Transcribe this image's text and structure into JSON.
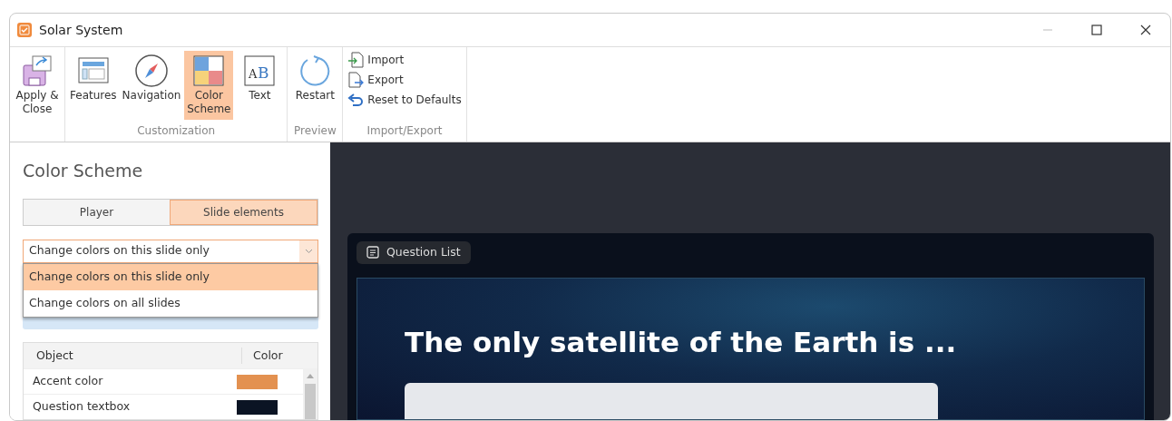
{
  "window": {
    "title": "Solar System"
  },
  "ribbon": {
    "groups": [
      {
        "items": [
          {
            "label": "Apply & Close",
            "kind": "large",
            "selected": false
          }
        ]
      },
      {
        "label": "Customization",
        "items": [
          {
            "label": "Features",
            "kind": "large",
            "selected": false
          },
          {
            "label": "Navigation",
            "kind": "large",
            "selected": false
          },
          {
            "label": "Color Scheme",
            "kind": "large",
            "selected": true
          },
          {
            "label": "Text",
            "kind": "large",
            "selected": false,
            "icon_letters": [
              "A",
              "B"
            ]
          }
        ]
      },
      {
        "label": "Preview",
        "items": [
          {
            "label": "Restart",
            "kind": "large",
            "selected": false
          }
        ]
      },
      {
        "label": "Import/Export",
        "items": [
          {
            "label": "Import",
            "kind": "small",
            "selected": false
          },
          {
            "label": "Export",
            "kind": "small",
            "selected": false
          },
          {
            "label": "Reset to Defaults",
            "kind": "small",
            "selected": false
          }
        ]
      }
    ]
  },
  "panel": {
    "title": "Color Scheme",
    "tabs": [
      {
        "label": "Player",
        "selected": false
      },
      {
        "label": "Slide elements",
        "selected": true
      }
    ],
    "dropdown": {
      "value": "Change colors on this slide only",
      "expanded": true,
      "options": [
        {
          "label": "Change colors on this slide only",
          "selected": true
        },
        {
          "label": "Change colors on all slides",
          "selected": false
        }
      ]
    },
    "table": {
      "columns": [
        "Object",
        "Color"
      ],
      "rows": [
        {
          "object": "Accent color",
          "color": "#e39150"
        },
        {
          "object": "Question textbox",
          "color": "#0b1424"
        }
      ]
    }
  },
  "preview": {
    "question_list_button": "Question List",
    "question": "The only satellite of the Earth is ..."
  }
}
